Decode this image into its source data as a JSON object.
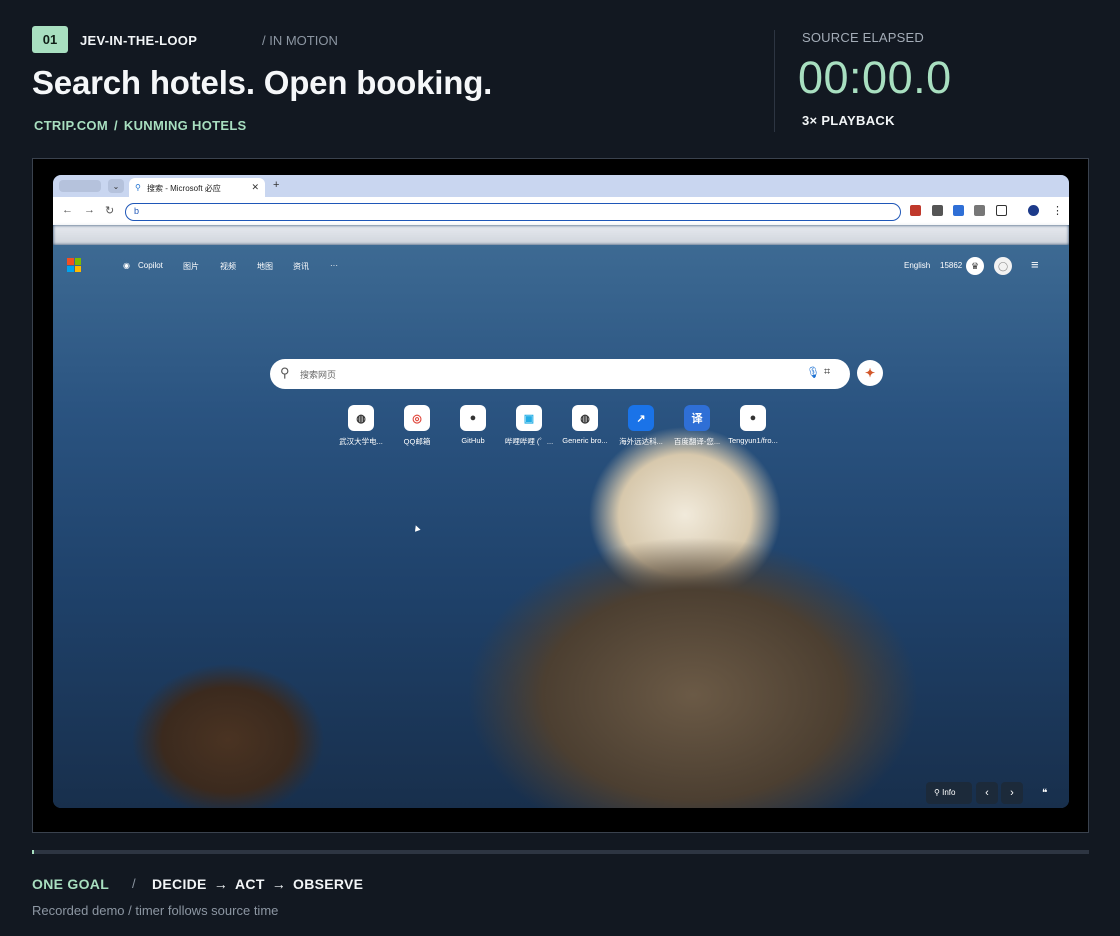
{
  "header": {
    "step_number": "01",
    "brand": "JEV-IN-THE-LOOP",
    "motion_label": "/ IN MOTION",
    "headline": "Search hotels. Open booking.",
    "breadcrumb": {
      "site": "CTRIP.COM",
      "separator": "/",
      "section": "KUNMING HOTELS"
    }
  },
  "timer": {
    "label": "SOURCE ELAPSED",
    "value": "00:00.0",
    "playback": "3× PLAYBACK"
  },
  "browser": {
    "tab_title": "搜索 - Microsoft 必应",
    "address_value": "b",
    "page": {
      "nav_links": [
        "Copilot",
        "图片",
        "视频",
        "地图",
        "资讯",
        "···"
      ],
      "language": "English",
      "points": "15862",
      "search_placeholder": "搜索网页",
      "shortcuts": [
        {
          "label": "武汉大学电...",
          "icon": "globe-icon"
        },
        {
          "label": "QQ邮箱",
          "icon": "chrome-icon"
        },
        {
          "label": "GitHub",
          "icon": "github-icon"
        },
        {
          "label": "哔哩哔哩 (゜...",
          "icon": "bilibili-icon"
        },
        {
          "label": "Generic bro...",
          "icon": "globe-icon"
        },
        {
          "label": "海外远达科...",
          "icon": "app-icon"
        },
        {
          "label": "百度翻译-您...",
          "icon": "translate-icon"
        },
        {
          "label": "Tengyun1/fro...",
          "icon": "github-icon"
        }
      ],
      "info_label": "Info"
    }
  },
  "progress": {
    "fraction": 0.0
  },
  "footer": {
    "goal": "ONE GOAL",
    "divider": "/",
    "loop": [
      "DECIDE",
      "ACT",
      "OBSERVE"
    ],
    "arrow": "→",
    "note": "Recorded demo / timer follows source time"
  },
  "colors": {
    "accent": "#a8dfc0",
    "background": "#121821"
  }
}
